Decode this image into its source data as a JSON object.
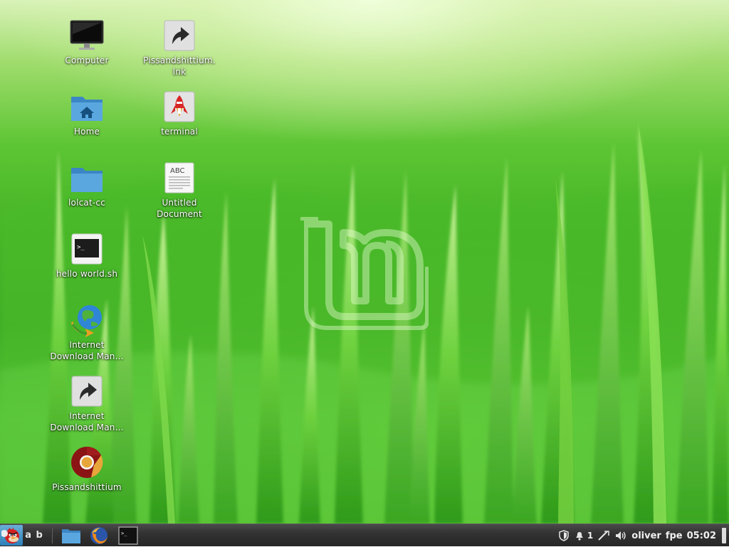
{
  "desktop": {
    "icons": [
      {
        "label": "Computer",
        "icon": "monitor-icon"
      },
      {
        "label": "Home",
        "icon": "home-folder-icon"
      },
      {
        "label": "lolcat-cc",
        "icon": "folder-icon"
      },
      {
        "label": "hello world.sh",
        "icon": "terminal-script-icon"
      },
      {
        "label": "Internet\nDownload Man...",
        "icon": "download-manager-icon"
      },
      {
        "label": "Internet\nDownload Man...",
        "icon": "shortcut-link-icon"
      },
      {
        "label": "Pissandshittium",
        "icon": "chromium-icon"
      },
      {
        "label": "Pissandshittium.\nlnk",
        "icon": "shortcut-link-icon"
      },
      {
        "label": "terminal",
        "icon": "rocket-launcher-icon"
      },
      {
        "label": "Untitled\nDocument",
        "icon": "text-document-icon"
      }
    ]
  },
  "panel": {
    "menu_icon": "angry-bird-menu-icon",
    "workspace_switcher": "a b",
    "launchers": [
      "file-manager-icon",
      "firefox-icon",
      "terminal-icon"
    ],
    "tray": {
      "notification_count": "1",
      "user": "oliver",
      "user_extra": "fpe",
      "clock": "05:02"
    }
  },
  "colors": {
    "panel_bg": "#2e2e2e",
    "label_text": "#ffffff",
    "grass_green": "#44b326"
  }
}
